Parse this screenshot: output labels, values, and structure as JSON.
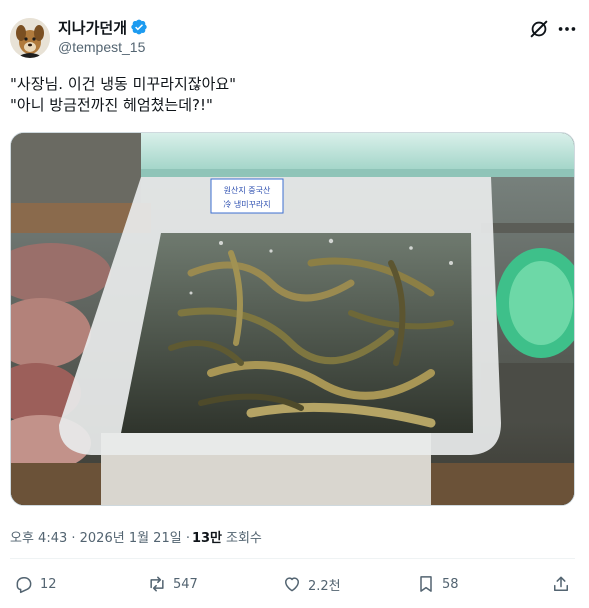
{
  "author": {
    "display_name": "지나가던개",
    "handle": "@tempest_15",
    "verified": true,
    "avatar_icon": "dog-avatar-icon"
  },
  "toolbar": {
    "grok_icon": "grok-slash-icon",
    "more_icon": "more-horizontal-icon"
  },
  "tweet": {
    "lines": [
      "\"사장님. 이건 냉동 미꾸라지잖아요\"",
      "\"아니 방금전까진 헤엄쳤는데?!\""
    ],
    "media": {
      "label_line1": "원산지 중국산",
      "label_line2": "冷 냉미꾸라지"
    }
  },
  "meta": {
    "timestamp": "오후 4:43 · 2026년 1월 21일 · ",
    "views_count": "13만",
    "views_label": "조회수"
  },
  "actions": {
    "reply": {
      "icon": "reply-icon",
      "count": "12"
    },
    "retweet": {
      "icon": "retweet-icon",
      "count": "547"
    },
    "like": {
      "icon": "heart-icon",
      "count": "2.2천"
    },
    "bookmark": {
      "icon": "bookmark-icon",
      "count": "58"
    },
    "share": {
      "icon": "share-icon"
    }
  },
  "colors": {
    "verified_blue": "#1d9bf0",
    "text": "#0f1419",
    "secondary_text": "#536471",
    "border": "#cfd9de"
  }
}
